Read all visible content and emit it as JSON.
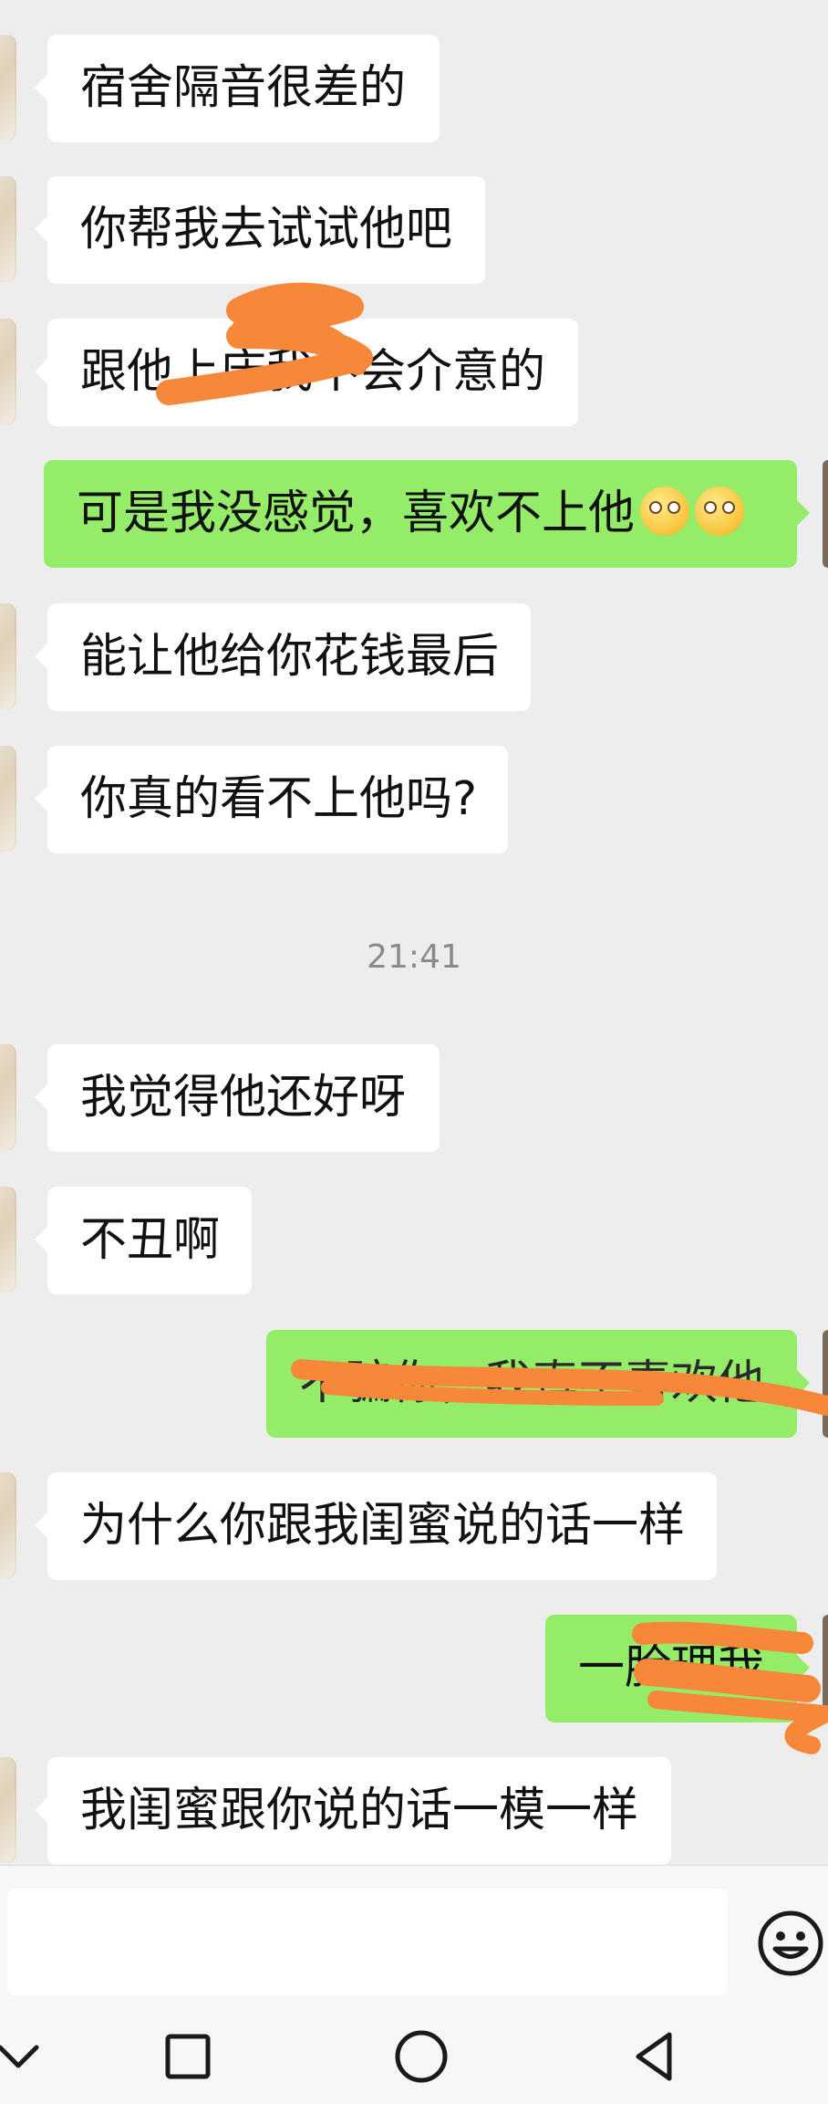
{
  "messages": [
    {
      "side": "left",
      "text": "宿舍隔音很差的"
    },
    {
      "side": "left",
      "text": "你帮我去试试他吧"
    },
    {
      "side": "left",
      "text": "跟他上床我不会介意的"
    },
    {
      "side": "right",
      "text": "可是我没感觉，喜欢不上他"
    },
    {
      "side": "left",
      "text": "能让他给你花钱最后"
    },
    {
      "side": "left",
      "text": "你真的看不上他吗?"
    },
    {
      "side": "left",
      "text": "我觉得他还好呀"
    },
    {
      "side": "left",
      "text": "不丑啊"
    },
    {
      "side": "right",
      "text": "不骗你，我真不喜欢他"
    },
    {
      "side": "left",
      "text": "为什么你跟我闺蜜说的话一样"
    },
    {
      "side": "right",
      "text": "一脸理我"
    },
    {
      "side": "left",
      "text": "我闺蜜跟你说的话一模一样"
    }
  ],
  "timestamp": "21:41",
  "icons": {
    "emoji_in_message": "grinning-face-emoji",
    "emoji_button": "smiley-face-icon",
    "nav_back": "chevron-down-icon",
    "nav_recents": "square-icon",
    "nav_home": "circle-icon",
    "nav_back_triangle": "triangle-back-icon"
  },
  "colors": {
    "bubble_self": "#95ec69",
    "bubble_other": "#ffffff",
    "background": "#ededed",
    "scribble": "#f7883a"
  }
}
